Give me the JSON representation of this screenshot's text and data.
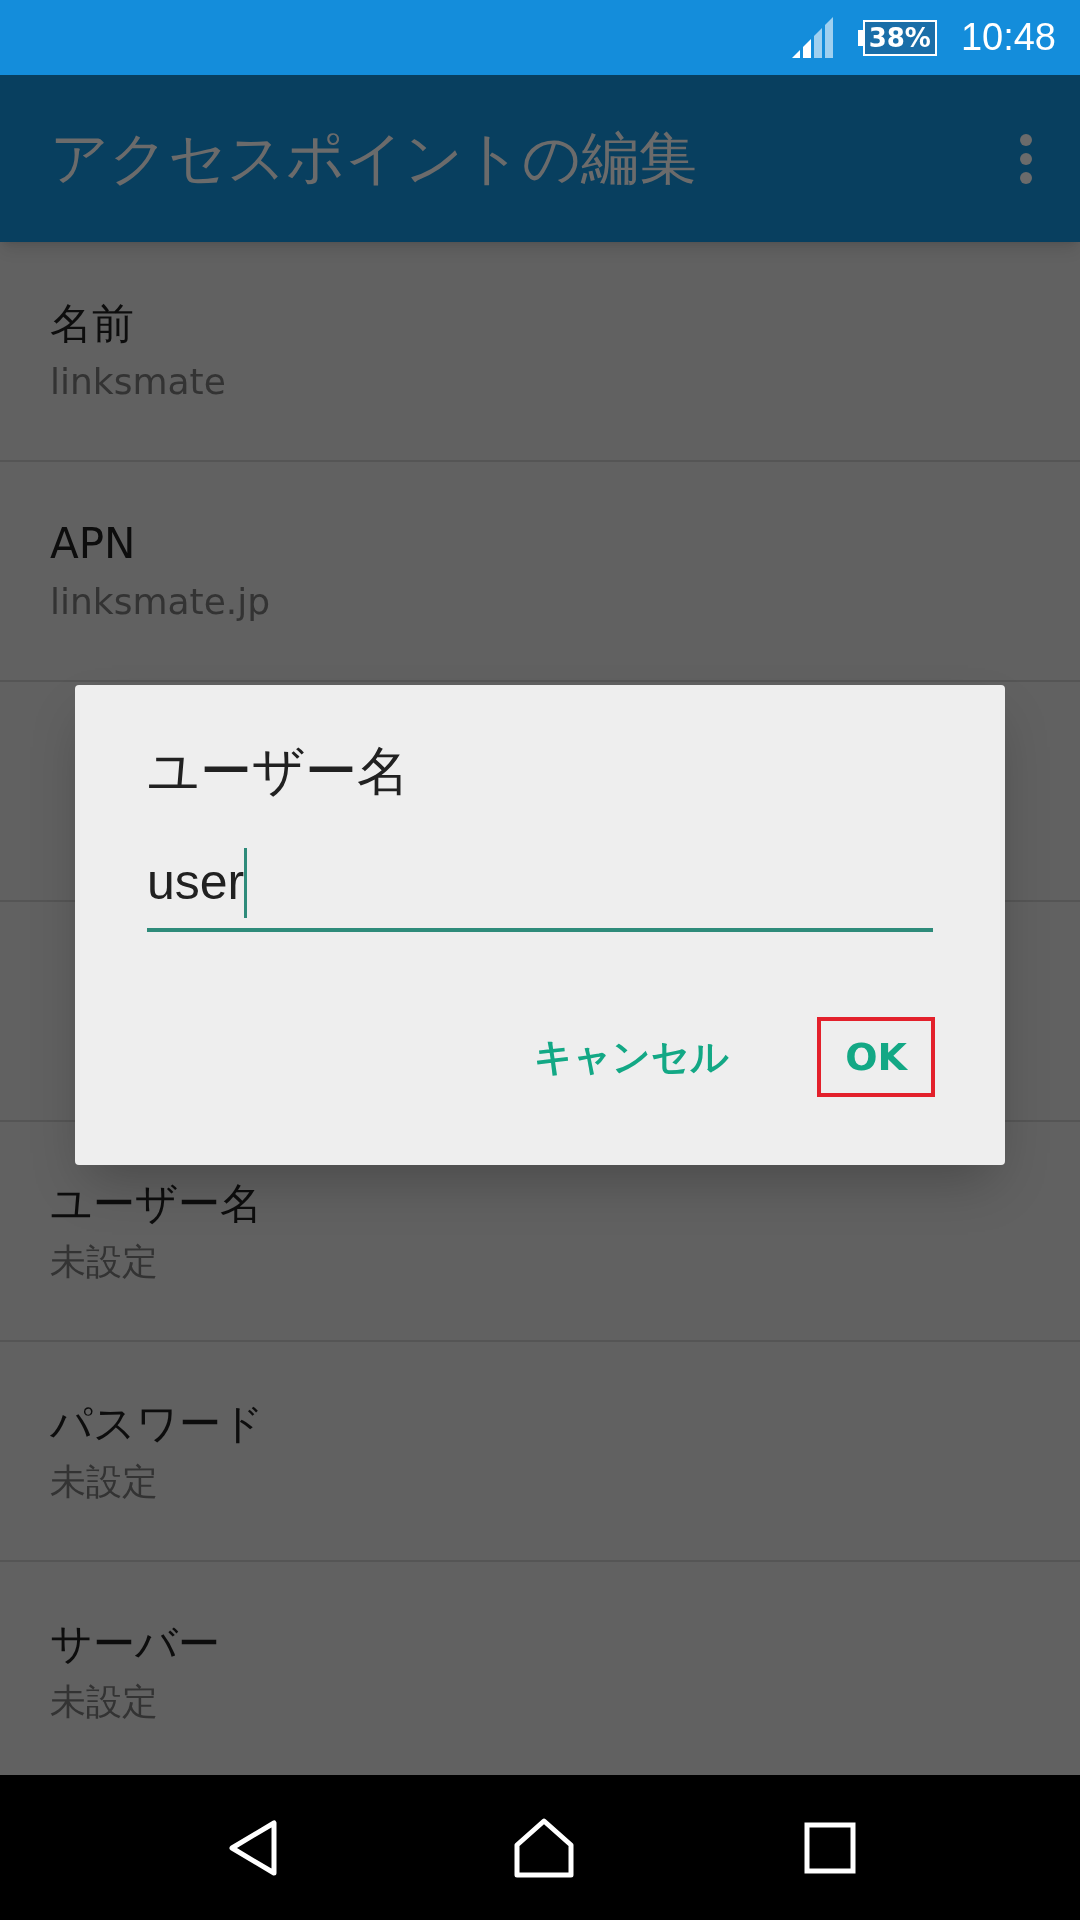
{
  "status_bar": {
    "battery": "38%",
    "time": "10:48"
  },
  "app_bar": {
    "title": "アクセスポイントの編集"
  },
  "settings_above_dialog": [
    {
      "title": "名前",
      "value": "linksmate"
    },
    {
      "title": "APN",
      "value": "linksmate.jp"
    }
  ],
  "settings_below_dialog": [
    {
      "title": "ユーザー名",
      "value": "未設定"
    },
    {
      "title": "パスワード",
      "value": "未設定"
    },
    {
      "title": "サーバー",
      "value": "未設定"
    }
  ],
  "dialog": {
    "title": "ユーザー名",
    "value": "user",
    "buttons": [
      {
        "label": "キャンセル",
        "highlighted": false
      },
      {
        "label": "OK",
        "highlighted": true
      }
    ]
  }
}
